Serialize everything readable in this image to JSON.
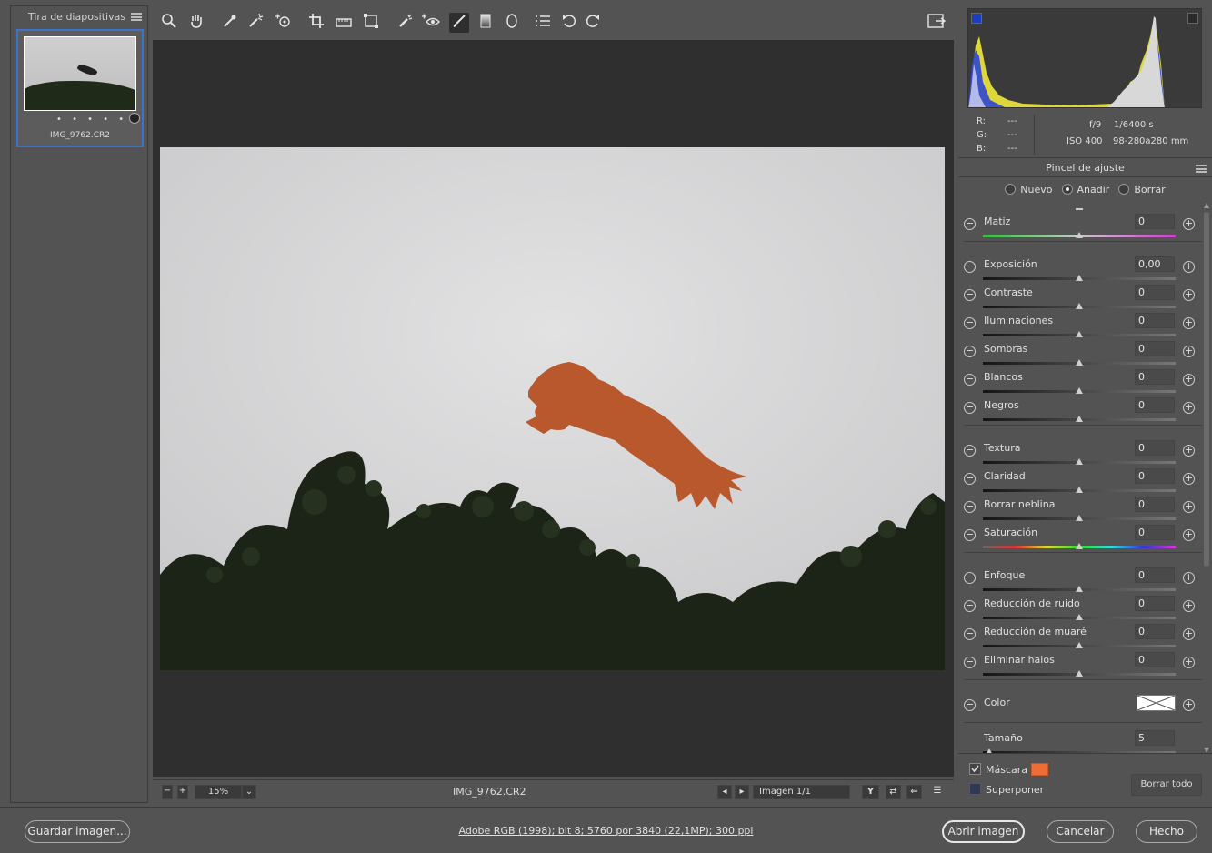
{
  "filmstrip": {
    "title": "Tira de diapositivas",
    "thumb_dots": "• • • • •",
    "thumb_name": "IMG_9762.CR2"
  },
  "status": {
    "zoom": "15%",
    "filename": "IMG_9762.CR2",
    "image_counter": "Imagen 1/1",
    "y_label": "Y"
  },
  "exif": {
    "r_label": "R:",
    "g_label": "G:",
    "b_label": "B:",
    "r_value": "---",
    "g_value": "---",
    "b_value": "---",
    "aperture": "f/9",
    "shutter": "1/6400 s",
    "iso": "ISO 400",
    "lens": "98-280a280 mm"
  },
  "panel": {
    "title": "Pincel de ajuste",
    "modes": [
      {
        "label": "Nuevo",
        "selected": false
      },
      {
        "label": "Añadir",
        "selected": true
      },
      {
        "label": "Borrar",
        "selected": false
      }
    ],
    "sliders": [
      {
        "label": "Matiz",
        "value": "0"
      },
      {
        "label": "Exposición",
        "value": "0,00"
      },
      {
        "label": "Contraste",
        "value": "0"
      },
      {
        "label": "Iluminaciones",
        "value": "0"
      },
      {
        "label": "Sombras",
        "value": "0"
      },
      {
        "label": "Blancos",
        "value": "0"
      },
      {
        "label": "Negros",
        "value": "0"
      },
      {
        "label": "Textura",
        "value": "0"
      },
      {
        "label": "Claridad",
        "value": "0"
      },
      {
        "label": "Borrar neblina",
        "value": "0"
      },
      {
        "label": "Saturación",
        "value": "0"
      },
      {
        "label": "Enfoque",
        "value": "0"
      },
      {
        "label": "Reducción de ruido",
        "value": "0"
      },
      {
        "label": "Reducción de muaré",
        "value": "0"
      },
      {
        "label": "Eliminar halos",
        "value": "0"
      },
      {
        "label": "Color",
        "value": ""
      },
      {
        "label": "Tamaño",
        "value": "5"
      }
    ],
    "mask_label": "Máscara",
    "mask_checked": true,
    "mask_color": "#ee6c35",
    "overlay_label": "Superponer",
    "overlay_checked": false,
    "clear_all": "Borrar todo"
  },
  "bottom": {
    "save": "Guardar imagen...",
    "workflow": "Adobe RGB (1998); bit 8; 5760 por 3840 (22,1MP); 300 ppi",
    "open": "Abrir imagen",
    "cancel": "Cancelar",
    "done": "Hecho"
  },
  "icons": [
    "zoom-icon",
    "hand-icon",
    "white-balance-icon",
    "color-sampler-icon",
    "target-adjust-icon",
    "crop-icon",
    "straighten-icon",
    "transform-icon",
    "spot-removal-icon",
    "red-eye-icon",
    "adjustment-brush-icon",
    "graduated-filter-icon",
    "radial-filter-icon",
    "presets-list-icon",
    "rotate-left-icon",
    "rotate-right-icon",
    "fullscreen-icon"
  ],
  "colors": {
    "selection_blue": "#3d74c9",
    "bird_overlay": "#b8582c"
  }
}
